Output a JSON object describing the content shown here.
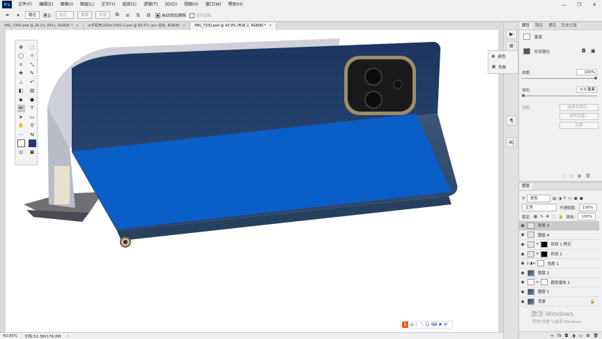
{
  "app": {
    "logo": "Ps"
  },
  "menu": [
    "文件(F)",
    "编辑(E)",
    "图像(I)",
    "图层(L)",
    "文字(Y)",
    "选择(S)",
    "滤镜(T)",
    "3D(D)",
    "视图(V)",
    "窗口(W)",
    "帮助(H)"
  ],
  "window_controls": {
    "minimize": "—",
    "maximize": "❐",
    "close": "✕"
  },
  "options": {
    "mode": "路径",
    "make": "选区...",
    "mask": "蒙版",
    "shape": "形状",
    "auto_add_delete": "自动添加/删除",
    "align_edges": "对齐边缘"
  },
  "tabs": [
    {
      "label": "IMG_7260.psd @ 24.1% (IP11, RGB/8) *",
      "active": false
    },
    {
      "label": "xr手机壳1000x1500-2.psd @ 60.5% (pvr 蓝色, RGB/8)",
      "active": false
    },
    {
      "label": "IMG_7332.psd @ 43.9% (形状 2, RGB/8) *",
      "active": true
    }
  ],
  "tab_close": "×",
  "tools": [
    "move-icon",
    "marquee-icon",
    "lasso-icon",
    "magic-wand-icon",
    "crop-icon",
    "eyedropper-icon",
    "healing-icon",
    "brush-icon",
    "stamp-icon",
    "history-brush-icon",
    "eraser-icon",
    "gradient-icon",
    "blur-icon",
    "dodge-icon",
    "pen-icon",
    "type-icon",
    "path-select-icon",
    "rectangle-icon",
    "hand-icon",
    "zoom-icon"
  ],
  "colors": {
    "blue_fill": "#0a5ec7",
    "background_chip": "#1f3a73"
  },
  "flyout": {
    "item1": "颜色",
    "item2": "色板"
  },
  "properties": {
    "tabs": [
      {
        "label": "属性",
        "active": true
      },
      {
        "label": "路径",
        "active": false
      },
      {
        "label": "通道",
        "active": false
      },
      {
        "label": "历史记录",
        "active": false
      }
    ],
    "mask_title": "蒙版",
    "shape_path": "形状路径",
    "density_label": "浓度:",
    "density_value": "100%",
    "feather_label": "羽化:",
    "feather_value": "0.0 像素",
    "adjust_label": "调整:",
    "select_mask": "选择并遮住...",
    "color_range": "颜色范围...",
    "invert": "反相"
  },
  "layers": {
    "title": "图层",
    "filter_kind": "类型",
    "blend_mode": "正常",
    "opacity_label": "不透明度:",
    "opacity_value": "100%",
    "lock_label": "锁定:",
    "fill_label": "填充:",
    "fill_value": "100%",
    "rows": [
      {
        "name": "形状 2",
        "selected": true
      },
      {
        "name": "图层 4",
        "selected": false
      },
      {
        "name": "形状 1 拷贝",
        "selected": false
      },
      {
        "name": "形状 1",
        "selected": false
      },
      {
        "name": "色阶 1",
        "selected": false
      },
      {
        "name": "图层 2",
        "selected": false
      },
      {
        "name": "颜色填充 1",
        "selected": false
      },
      {
        "name": "图层 1",
        "selected": false
      },
      {
        "name": "背景",
        "selected": false
      }
    ]
  },
  "status": {
    "zoom": "43.85%",
    "doc": "文档:51.3M/176.8M"
  },
  "ime": {
    "lang": "中"
  },
  "watermark": {
    "line1": "激活 Windows",
    "line2": "转到\"设置\"以激活 Windows。"
  }
}
